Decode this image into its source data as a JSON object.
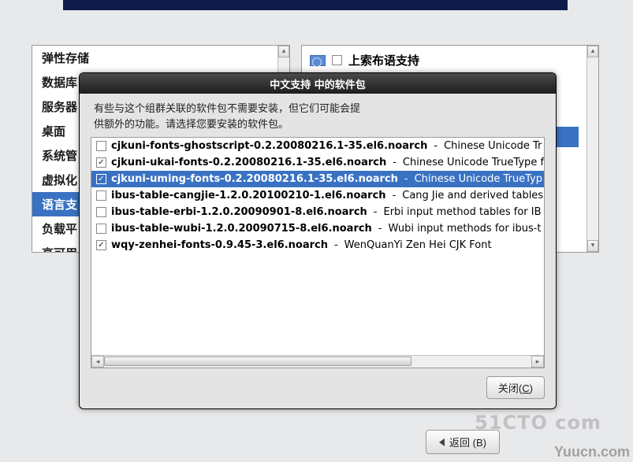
{
  "left_categories": {
    "items": [
      {
        "label": "弹性存储"
      },
      {
        "label": "数据库"
      },
      {
        "label": "服务器"
      },
      {
        "label": "桌面"
      },
      {
        "label": "系统管"
      },
      {
        "label": "虚拟化"
      },
      {
        "label": "语言支"
      },
      {
        "label": "负载平"
      },
      {
        "label": "高可用"
      }
    ],
    "selected_index": 6
  },
  "right_panel": {
    "header": {
      "label": "上索布语支持",
      "checked": false
    },
    "selected_blank": true
  },
  "dialog": {
    "title": "中文支持 中的软件包",
    "desc_line1": "有些与这个组群关联的软件包不需要安装，但它们可能会提",
    "desc_line2": "供额外的功能。请选择您要安装的软件包。",
    "packages": [
      {
        "checked": false,
        "name": "cjkuni-fonts-ghostscript-0.2.20080216.1-35.el6.noarch",
        "desc": "Chinese Unicode Tr"
      },
      {
        "checked": true,
        "name": "cjkuni-ukai-fonts-0.2.20080216.1-35.el6.noarch",
        "desc": "Chinese Unicode TrueType f"
      },
      {
        "checked": true,
        "name": "cjkuni-uming-fonts-0.2.20080216.1-35.el6.noarch",
        "desc": "Chinese Unicode TrueTyp"
      },
      {
        "checked": false,
        "name": "ibus-table-cangjie-1.2.0.20100210-1.el6.noarch",
        "desc": "Cang Jie and derived tables"
      },
      {
        "checked": false,
        "name": "ibus-table-erbi-1.2.0.20090901-8.el6.noarch",
        "desc": "Erbi input method tables for IB"
      },
      {
        "checked": false,
        "name": "ibus-table-wubi-1.2.0.20090715-8.el6.noarch",
        "desc": "Wubi input methods for ibus-t"
      },
      {
        "checked": true,
        "name": "wqy-zenhei-fonts-0.9.45-3.el6.noarch",
        "desc": "WenQuanYi Zen Hei CJK Font"
      }
    ],
    "selected_package_index": 2,
    "close_button": {
      "prefix": "关闭(",
      "key": "C",
      "suffix": ")"
    }
  },
  "nav": {
    "back": {
      "prefix": "返回 (",
      "key": "B",
      "suffix": ")"
    }
  },
  "watermarks": {
    "w1": "Yuucn.com",
    "w2": "51CTO com"
  }
}
